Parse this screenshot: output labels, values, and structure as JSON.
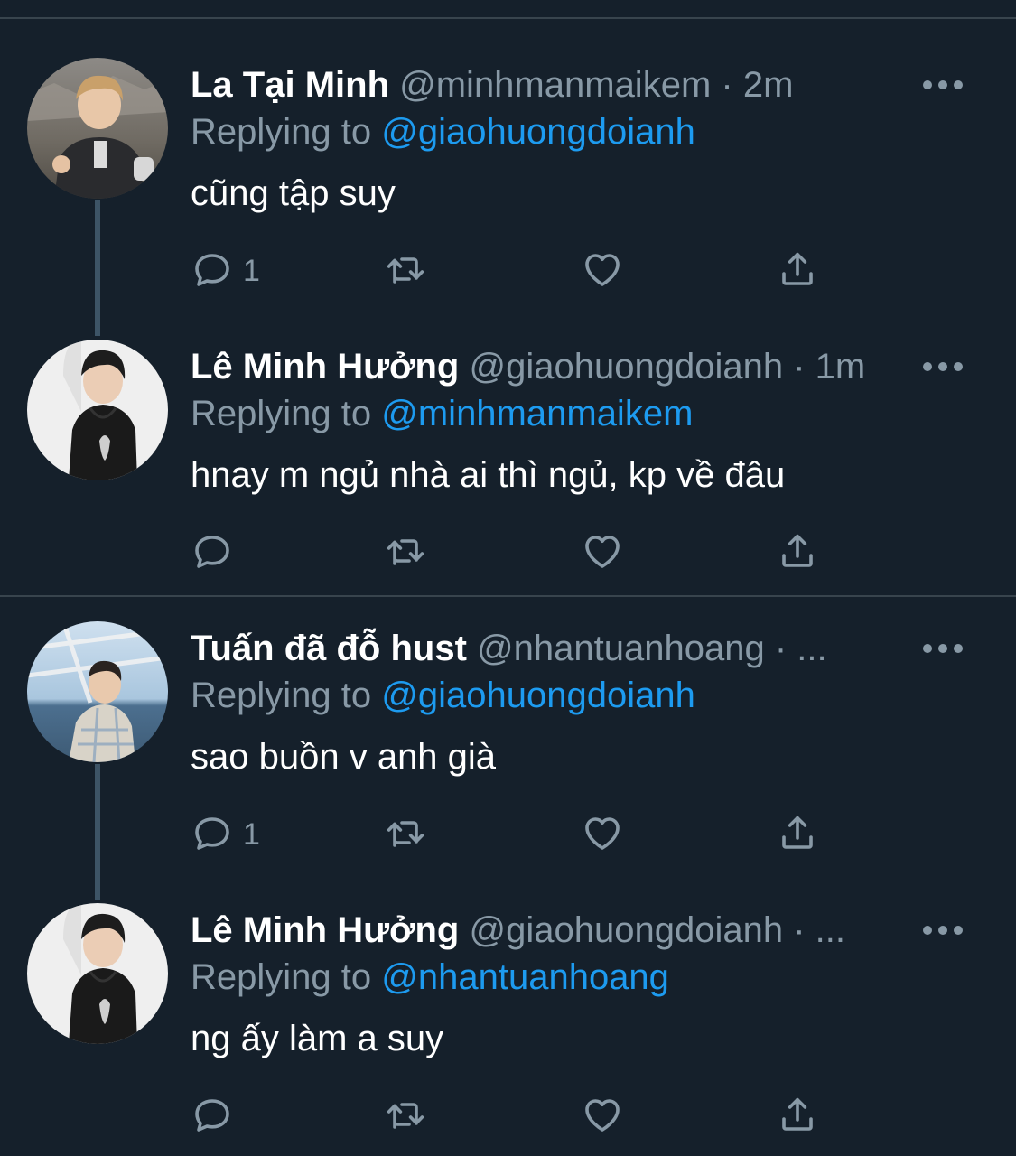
{
  "colors": {
    "background": "#15202b",
    "divider": "#38444d",
    "secondary_text": "#8899a6",
    "mention": "#1d9bf0",
    "thread_line": "#3d5466"
  },
  "icons": {
    "reply": "reply-icon",
    "retweet": "retweet-icon",
    "like": "like-icon",
    "share": "share-icon",
    "more": "more-icon"
  },
  "tweets": [
    {
      "name": "La Tại Minh",
      "handle": "@minhmanmaikem",
      "separator": "·",
      "time": "2m",
      "replying_label": "Replying to",
      "replying_to": "@giaohuongdoianh",
      "text": "cũng tập suy",
      "reply_count": "1"
    },
    {
      "name": "Lê Minh Hưởng",
      "handle": "@giaohuongdoianh",
      "separator": "·",
      "time": "1m",
      "replying_label": "Replying to",
      "replying_to": "@minhmanmaikem",
      "text": "hnay m ngủ nhà ai thì ngủ, kp về đâu",
      "reply_count": ""
    },
    {
      "name": "Tuấn đã đỗ hust",
      "handle": "@nhantuanhoang",
      "separator": "·",
      "time": "...",
      "replying_label": "Replying to",
      "replying_to": "@giaohuongdoianh",
      "text": "sao buồn v anh già",
      "reply_count": "1"
    },
    {
      "name": "Lê Minh Hưởng",
      "handle": "@giaohuongdoianh",
      "separator": "·",
      "time": "...",
      "replying_label": "Replying to",
      "replying_to": "@nhantuanhoang",
      "text": "ng ấy làm a suy",
      "reply_count": ""
    }
  ]
}
